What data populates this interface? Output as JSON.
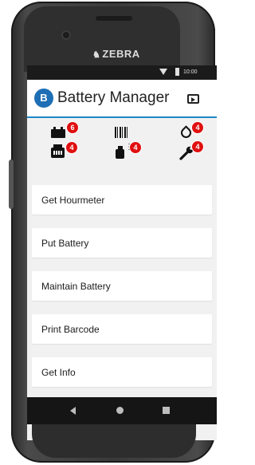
{
  "device": {
    "brand": "ZEBRA"
  },
  "status_bar": {
    "time": "10:00"
  },
  "app": {
    "logo_text": "B",
    "title": "Battery Manager"
  },
  "icon_badges": {
    "battery": "6",
    "barcode": "",
    "water": "4",
    "printer": "4",
    "sprayer": "4",
    "wrench": "4"
  },
  "menu": {
    "items": [
      {
        "label": "Get Hourmeter"
      },
      {
        "label": "Put Battery"
      },
      {
        "label": "Maintain Battery"
      },
      {
        "label": "Print Barcode"
      },
      {
        "label": "Get Info"
      }
    ]
  },
  "colors": {
    "accent": "#1e88c8",
    "badge": "#e01010",
    "logo": "#1e6fb5"
  }
}
